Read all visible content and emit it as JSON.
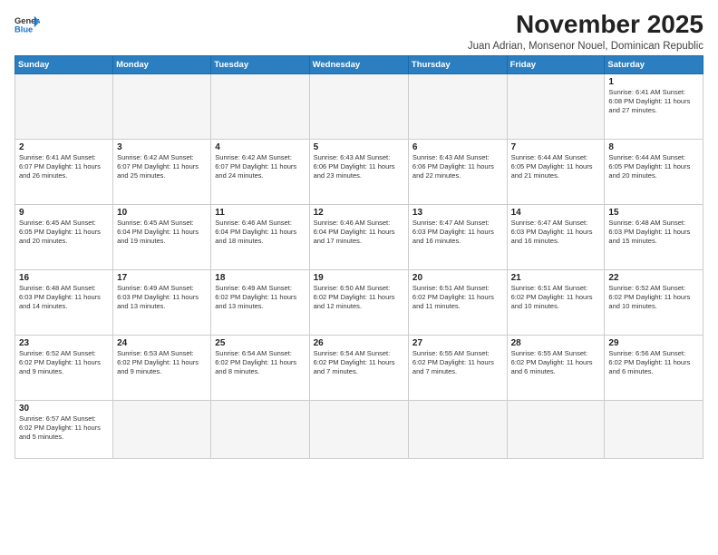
{
  "logo": {
    "text_general": "General",
    "text_blue": "Blue"
  },
  "title": "November 2025",
  "subtitle": "Juan Adrian, Monsenor Nouel, Dominican Republic",
  "days_of_week": [
    "Sunday",
    "Monday",
    "Tuesday",
    "Wednesday",
    "Thursday",
    "Friday",
    "Saturday"
  ],
  "weeks": [
    [
      {
        "day": "",
        "info": ""
      },
      {
        "day": "",
        "info": ""
      },
      {
        "day": "",
        "info": ""
      },
      {
        "day": "",
        "info": ""
      },
      {
        "day": "",
        "info": ""
      },
      {
        "day": "",
        "info": ""
      },
      {
        "day": "1",
        "info": "Sunrise: 6:41 AM\nSunset: 6:08 PM\nDaylight: 11 hours\nand 27 minutes."
      }
    ],
    [
      {
        "day": "2",
        "info": "Sunrise: 6:41 AM\nSunset: 6:07 PM\nDaylight: 11 hours\nand 26 minutes."
      },
      {
        "day": "3",
        "info": "Sunrise: 6:42 AM\nSunset: 6:07 PM\nDaylight: 11 hours\nand 25 minutes."
      },
      {
        "day": "4",
        "info": "Sunrise: 6:42 AM\nSunset: 6:07 PM\nDaylight: 11 hours\nand 24 minutes."
      },
      {
        "day": "5",
        "info": "Sunrise: 6:43 AM\nSunset: 6:06 PM\nDaylight: 11 hours\nand 23 minutes."
      },
      {
        "day": "6",
        "info": "Sunrise: 6:43 AM\nSunset: 6:06 PM\nDaylight: 11 hours\nand 22 minutes."
      },
      {
        "day": "7",
        "info": "Sunrise: 6:44 AM\nSunset: 6:05 PM\nDaylight: 11 hours\nand 21 minutes."
      },
      {
        "day": "8",
        "info": "Sunrise: 6:44 AM\nSunset: 6:05 PM\nDaylight: 11 hours\nand 20 minutes."
      }
    ],
    [
      {
        "day": "9",
        "info": "Sunrise: 6:45 AM\nSunset: 6:05 PM\nDaylight: 11 hours\nand 20 minutes."
      },
      {
        "day": "10",
        "info": "Sunrise: 6:45 AM\nSunset: 6:04 PM\nDaylight: 11 hours\nand 19 minutes."
      },
      {
        "day": "11",
        "info": "Sunrise: 6:46 AM\nSunset: 6:04 PM\nDaylight: 11 hours\nand 18 minutes."
      },
      {
        "day": "12",
        "info": "Sunrise: 6:46 AM\nSunset: 6:04 PM\nDaylight: 11 hours\nand 17 minutes."
      },
      {
        "day": "13",
        "info": "Sunrise: 6:47 AM\nSunset: 6:03 PM\nDaylight: 11 hours\nand 16 minutes."
      },
      {
        "day": "14",
        "info": "Sunrise: 6:47 AM\nSunset: 6:03 PM\nDaylight: 11 hours\nand 16 minutes."
      },
      {
        "day": "15",
        "info": "Sunrise: 6:48 AM\nSunset: 6:03 PM\nDaylight: 11 hours\nand 15 minutes."
      }
    ],
    [
      {
        "day": "16",
        "info": "Sunrise: 6:48 AM\nSunset: 6:03 PM\nDaylight: 11 hours\nand 14 minutes."
      },
      {
        "day": "17",
        "info": "Sunrise: 6:49 AM\nSunset: 6:03 PM\nDaylight: 11 hours\nand 13 minutes."
      },
      {
        "day": "18",
        "info": "Sunrise: 6:49 AM\nSunset: 6:02 PM\nDaylight: 11 hours\nand 13 minutes."
      },
      {
        "day": "19",
        "info": "Sunrise: 6:50 AM\nSunset: 6:02 PM\nDaylight: 11 hours\nand 12 minutes."
      },
      {
        "day": "20",
        "info": "Sunrise: 6:51 AM\nSunset: 6:02 PM\nDaylight: 11 hours\nand 11 minutes."
      },
      {
        "day": "21",
        "info": "Sunrise: 6:51 AM\nSunset: 6:02 PM\nDaylight: 11 hours\nand 10 minutes."
      },
      {
        "day": "22",
        "info": "Sunrise: 6:52 AM\nSunset: 6:02 PM\nDaylight: 11 hours\nand 10 minutes."
      }
    ],
    [
      {
        "day": "23",
        "info": "Sunrise: 6:52 AM\nSunset: 6:02 PM\nDaylight: 11 hours\nand 9 minutes."
      },
      {
        "day": "24",
        "info": "Sunrise: 6:53 AM\nSunset: 6:02 PM\nDaylight: 11 hours\nand 9 minutes."
      },
      {
        "day": "25",
        "info": "Sunrise: 6:54 AM\nSunset: 6:02 PM\nDaylight: 11 hours\nand 8 minutes."
      },
      {
        "day": "26",
        "info": "Sunrise: 6:54 AM\nSunset: 6:02 PM\nDaylight: 11 hours\nand 7 minutes."
      },
      {
        "day": "27",
        "info": "Sunrise: 6:55 AM\nSunset: 6:02 PM\nDaylight: 11 hours\nand 7 minutes."
      },
      {
        "day": "28",
        "info": "Sunrise: 6:55 AM\nSunset: 6:02 PM\nDaylight: 11 hours\nand 6 minutes."
      },
      {
        "day": "29",
        "info": "Sunrise: 6:56 AM\nSunset: 6:02 PM\nDaylight: 11 hours\nand 6 minutes."
      }
    ],
    [
      {
        "day": "30",
        "info": "Sunrise: 6:57 AM\nSunset: 6:02 PM\nDaylight: 11 hours\nand 5 minutes."
      },
      {
        "day": "",
        "info": ""
      },
      {
        "day": "",
        "info": ""
      },
      {
        "day": "",
        "info": ""
      },
      {
        "day": "",
        "info": ""
      },
      {
        "day": "",
        "info": ""
      },
      {
        "day": "",
        "info": ""
      }
    ]
  ]
}
